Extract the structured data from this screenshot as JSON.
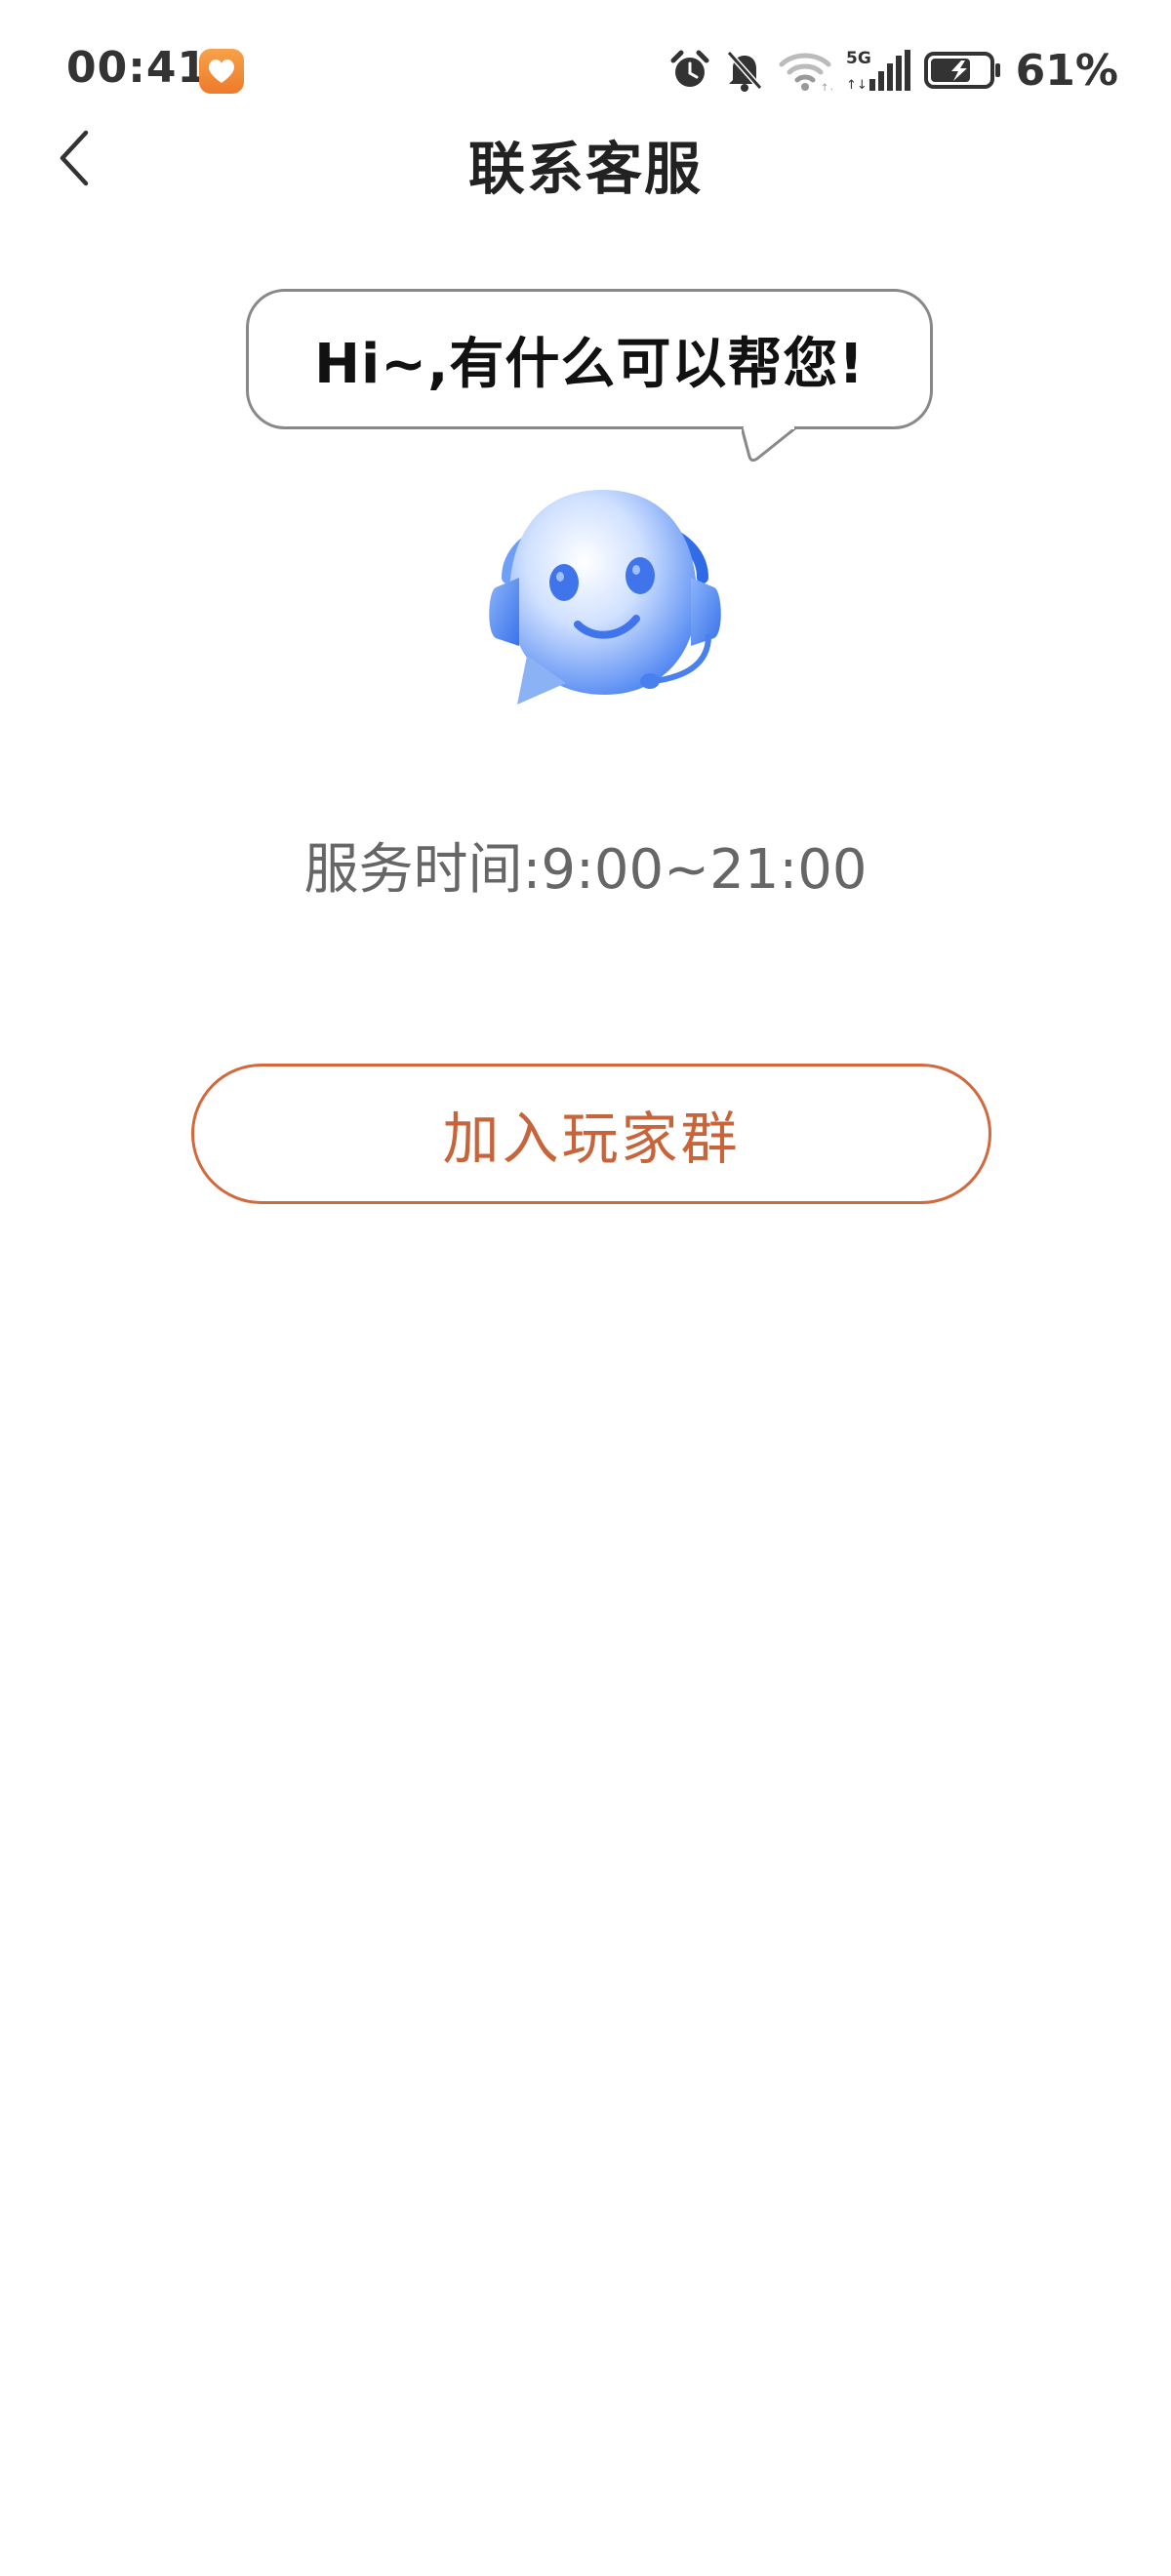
{
  "status_bar": {
    "time": "00:41",
    "network": "5G",
    "battery_percent": "61%"
  },
  "nav": {
    "title": "联系客服"
  },
  "main": {
    "greeting": "Hi~,有什么可以帮您!",
    "service_hours": "服务时间:9:00~21:00",
    "join_group_label": "加入玩家群"
  },
  "colors": {
    "accent": "#d2693c",
    "mascot_blue": "#4a86f0"
  }
}
